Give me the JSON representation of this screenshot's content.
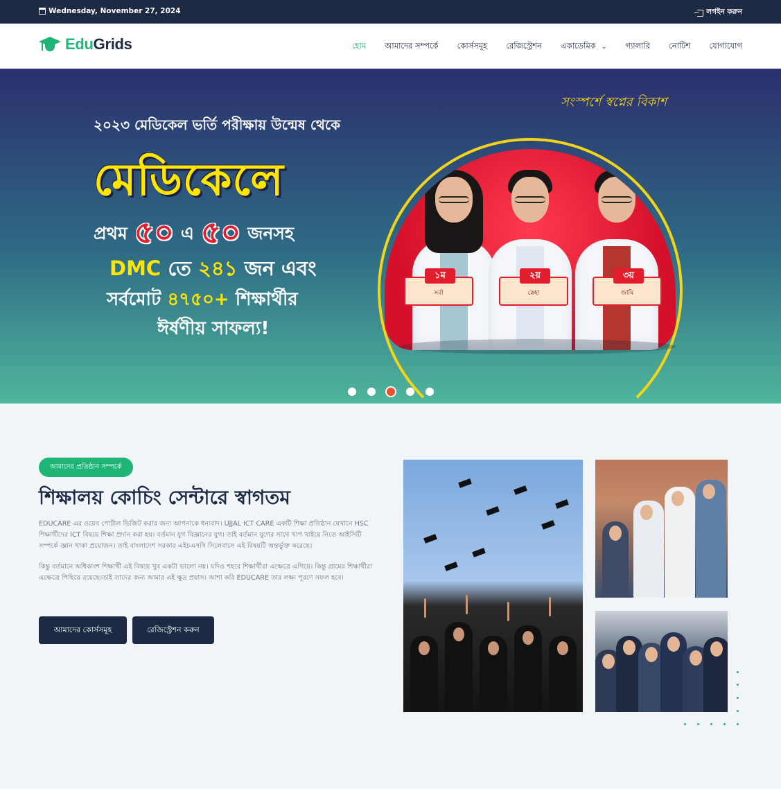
{
  "topbar": {
    "date": "Wednesday, November 27, 2024",
    "login": "লগইন করুন"
  },
  "brand": {
    "edu": "Edu",
    "grids": "Grids"
  },
  "nav": [
    {
      "label": "হোম",
      "active": true
    },
    {
      "label": "আমাদের সম্পর্কে"
    },
    {
      "label": "কোর্সসমূহ"
    },
    {
      "label": "রেজিস্ট্রেশন"
    },
    {
      "label": "একাডেমিক",
      "dropdown": true
    },
    {
      "label": "গ্যালারি"
    },
    {
      "label": "নোটিশ"
    },
    {
      "label": "যোগাযোগ"
    }
  ],
  "hero": {
    "tagline": "সংস্পর্শে স্বপ্নের বিকাশ",
    "line1": "২০২৩ মেডিকেল ভর্তি পরীক্ষায় উন্মেষ থেকে",
    "big": "মেডিকেলে",
    "line3_a": "প্রথম",
    "line3_n1": "৫০",
    "line3_mid": "এ",
    "line3_n2": "৫০",
    "line3_b": "জনসহ",
    "line4_a": "DMC",
    "line4_b": "তে",
    "line4_n": "২৪১",
    "line4_c": "জন এবং",
    "line5_a": "সর্বমোট",
    "line5_n": "৪৭৫০+",
    "line5_b": "শিক্ষার্থীর",
    "line6": "ঈর্ষণীয় সাফল্য!",
    "badges": [
      {
        "rank": "১ম",
        "name": "সর্বা"
      },
      {
        "rank": "২য়",
        "name": "স্নেহা"
      },
      {
        "rank": "৩য়",
        "name": "জামি"
      }
    ],
    "slides_total": 5,
    "slide_active": 3
  },
  "about": {
    "pill": "আমাদের প্রতিষ্ঠান সম্পর্কে",
    "title": "শিক্ষালয় কোচিং সেন্টারে স্বাগতম",
    "p1": "EDUCARE এর ওয়েব পোর্টাল ভিজিট করার জন্য আপনাকে ধন্যবাদ। UJJAL ICT CARE একটি শিক্ষা প্রতিষ্ঠান যেখানে HSC শিক্ষার্থীদের ICT বিষয়ে শিক্ষা প্রদান করা হয়। বর্তমান যুগ বিজ্ঞানের যুগ। তাই বর্তমান যুগের সাথে খাপ খাইয়ে নিতে আইসিটি সম্পর্কে জ্ঞান থাকা প্রয়োজন। তাই বাংলাদেশ সরকার এইচএসসি সিলেবাসে এই বিষয়টি অন্তর্ভুক্ত করেছে।",
    "p2": "কিন্তু বর্তমানে অধিকাংশ শিক্ষার্থী এই বিষয়ে খুব একটা ভালো নয়। যদিও শহরে শিক্ষার্থীরা এক্ষেত্রে এগিয়ে। কিন্তু গ্রামের শিক্ষার্থীরা এক্ষেত্রে পিছিয়ে রয়েছে।তাই তাদের জন্য আমার এই ক্ষুদ্র প্রয়াস। আশা করি EDUCARE তার লক্ষ্য পূরণে সফল হবে।",
    "btn_courses": "আমাদের কোর্সসমূহ",
    "btn_register": "রেজিস্ট্রেশন করুন"
  },
  "colors": {
    "navy": "#1d2a44",
    "green": "#1fb577",
    "accent_red": "#e21d2e",
    "yellow": "#ffe600"
  }
}
